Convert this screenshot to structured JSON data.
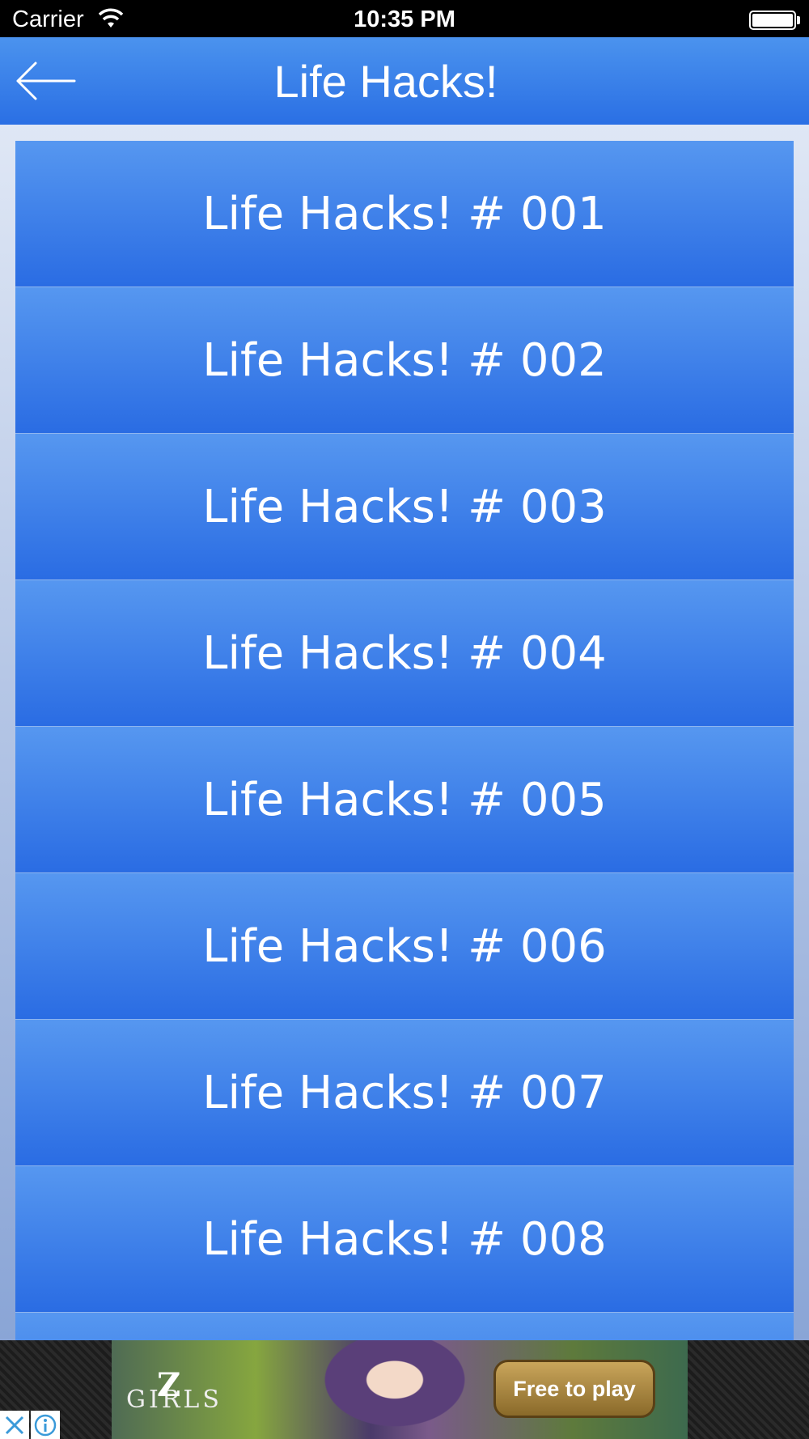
{
  "status_bar": {
    "carrier": "Carrier",
    "time": "10:35 PM"
  },
  "nav": {
    "title": "Life Hacks!",
    "back_icon": "back-arrow-icon"
  },
  "list": {
    "items": [
      "Life Hacks! # 001",
      "Life Hacks! # 002",
      "Life Hacks! # 003",
      "Life Hacks! # 004",
      "Life Hacks! # 005",
      "Life Hacks! # 006",
      "Life Hacks! # 007",
      "Life Hacks! # 008"
    ]
  },
  "ad": {
    "logo_text": "GIRLS",
    "logo_letter": "Z",
    "cta_label": "Free to play",
    "close_icon": "close-icon",
    "info_icon": "info-icon"
  },
  "colors": {
    "accent": "#3b82ea",
    "bar_gradient_top": "#4b93ee",
    "bar_gradient_bottom": "#2a6fe4"
  }
}
